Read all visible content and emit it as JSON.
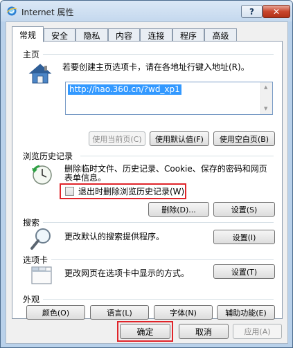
{
  "window": {
    "title": "Internet 属性",
    "help_label": "?",
    "close_label": "✕"
  },
  "tabs": [
    {
      "label": "常规",
      "active": true
    },
    {
      "label": "安全"
    },
    {
      "label": "隐私"
    },
    {
      "label": "内容"
    },
    {
      "label": "连接"
    },
    {
      "label": "程序"
    },
    {
      "label": "高级"
    }
  ],
  "homepage": {
    "title": "主页",
    "description": "若要创建主页选项卡，请在各地址行键入地址(R)。",
    "url": "http://hao.360.cn/?wd_xp1",
    "use_current": "使用当前页(C)",
    "use_default": "使用默认值(F)",
    "use_blank": "使用空白页(B)"
  },
  "history": {
    "title": "浏览历史记录",
    "description_line1": "删除临时文件、历史记录、Cookie、保存的密码和网页",
    "description_line2": "表单信息。",
    "checkbox_label": "退出时删除浏览历史记录(W)",
    "checkbox_checked": false,
    "delete_button": "删除(D)...",
    "settings_button": "设置(S)"
  },
  "search": {
    "title": "搜索",
    "description": "更改默认的搜索提供程序。",
    "settings_button": "设置(I)"
  },
  "tabs_section": {
    "title": "选项卡",
    "description": "更改网页在选项卡中显示的方式。",
    "settings_button": "设置(T)"
  },
  "appearance": {
    "title": "外观",
    "colors_button": "颜色(O)",
    "languages_button": "语言(L)",
    "fonts_button": "字体(N)",
    "accessibility_button": "辅助功能(E)"
  },
  "footer": {
    "ok_button": "确定",
    "cancel_button": "取消",
    "apply_button": "应用(A)"
  },
  "icons": {
    "app": "ie-globe-icon",
    "homepage": "house-icon",
    "history": "clock-arrow-icon",
    "search": "magnifier-icon",
    "tabs": "tabbed-window-icon"
  },
  "colors": {
    "highlight_box": "#e0242a",
    "url_selection": "#3399ff"
  }
}
